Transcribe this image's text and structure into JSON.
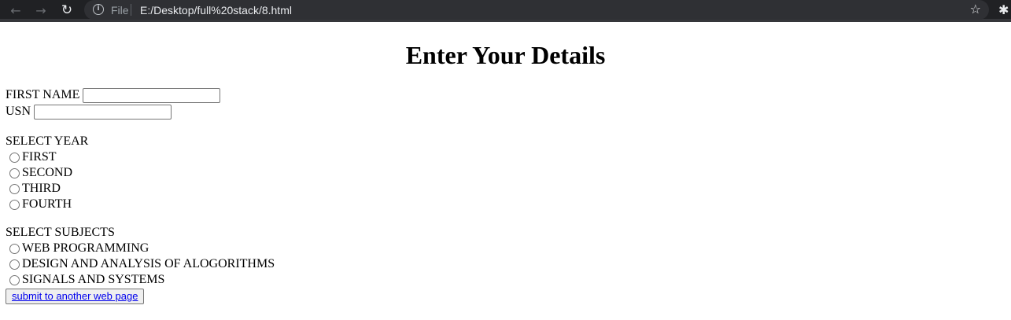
{
  "browser": {
    "scheme_label": "File",
    "url": "E:/Desktop/full%20stack/8.html",
    "icons": [
      "back-arrow-icon",
      "forward-arrow-icon",
      "reload-icon",
      "info-icon",
      "star-icon",
      "extensions-puzzle-icon"
    ]
  },
  "form": {
    "title": "Enter Your Details",
    "first_name_label": "FIRST NAME",
    "first_name_value": "",
    "usn_label": "USN",
    "usn_value": "",
    "year_label": "SELECT YEAR",
    "years": [
      "FIRST",
      "SECOND",
      "THIRD",
      "FOURTH"
    ],
    "subjects_label": "SELECT SUBJECTS",
    "subjects": [
      "WEB PROGRAMMING",
      "DESIGN AND ANALYSIS OF ALOGORITHMS",
      "SIGNALS AND SYSTEMS"
    ],
    "submit_label": "submit to another web page"
  }
}
